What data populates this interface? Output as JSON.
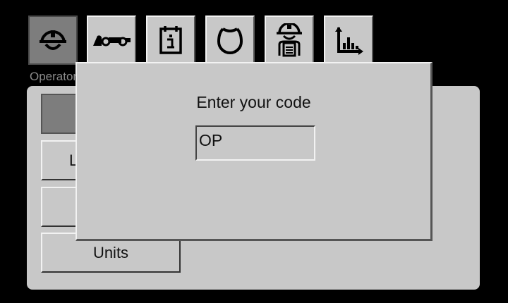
{
  "tabs": [
    {
      "icon": "operator-helmet-icon",
      "active": true
    },
    {
      "icon": "machine-vehicle-icon",
      "active": false
    },
    {
      "icon": "document-info-icon",
      "active": false
    },
    {
      "icon": "bucket-ring-icon",
      "active": false
    },
    {
      "icon": "person-clipboard-icon",
      "active": false
    },
    {
      "icon": "bar-chart-axes-icon",
      "active": false
    }
  ],
  "active_tab_caption": "Operator",
  "menu": {
    "items": [
      {
        "label": "",
        "selected": true
      },
      {
        "label": "L",
        "selected": false
      },
      {
        "label": "",
        "selected": false
      },
      {
        "label": "Units",
        "selected": false
      }
    ]
  },
  "dialog": {
    "title": "Enter your code",
    "code_value": "OP"
  },
  "colors": {
    "background": "#000000",
    "panel": "#c8c8c8",
    "active": "#7d7d7d"
  }
}
